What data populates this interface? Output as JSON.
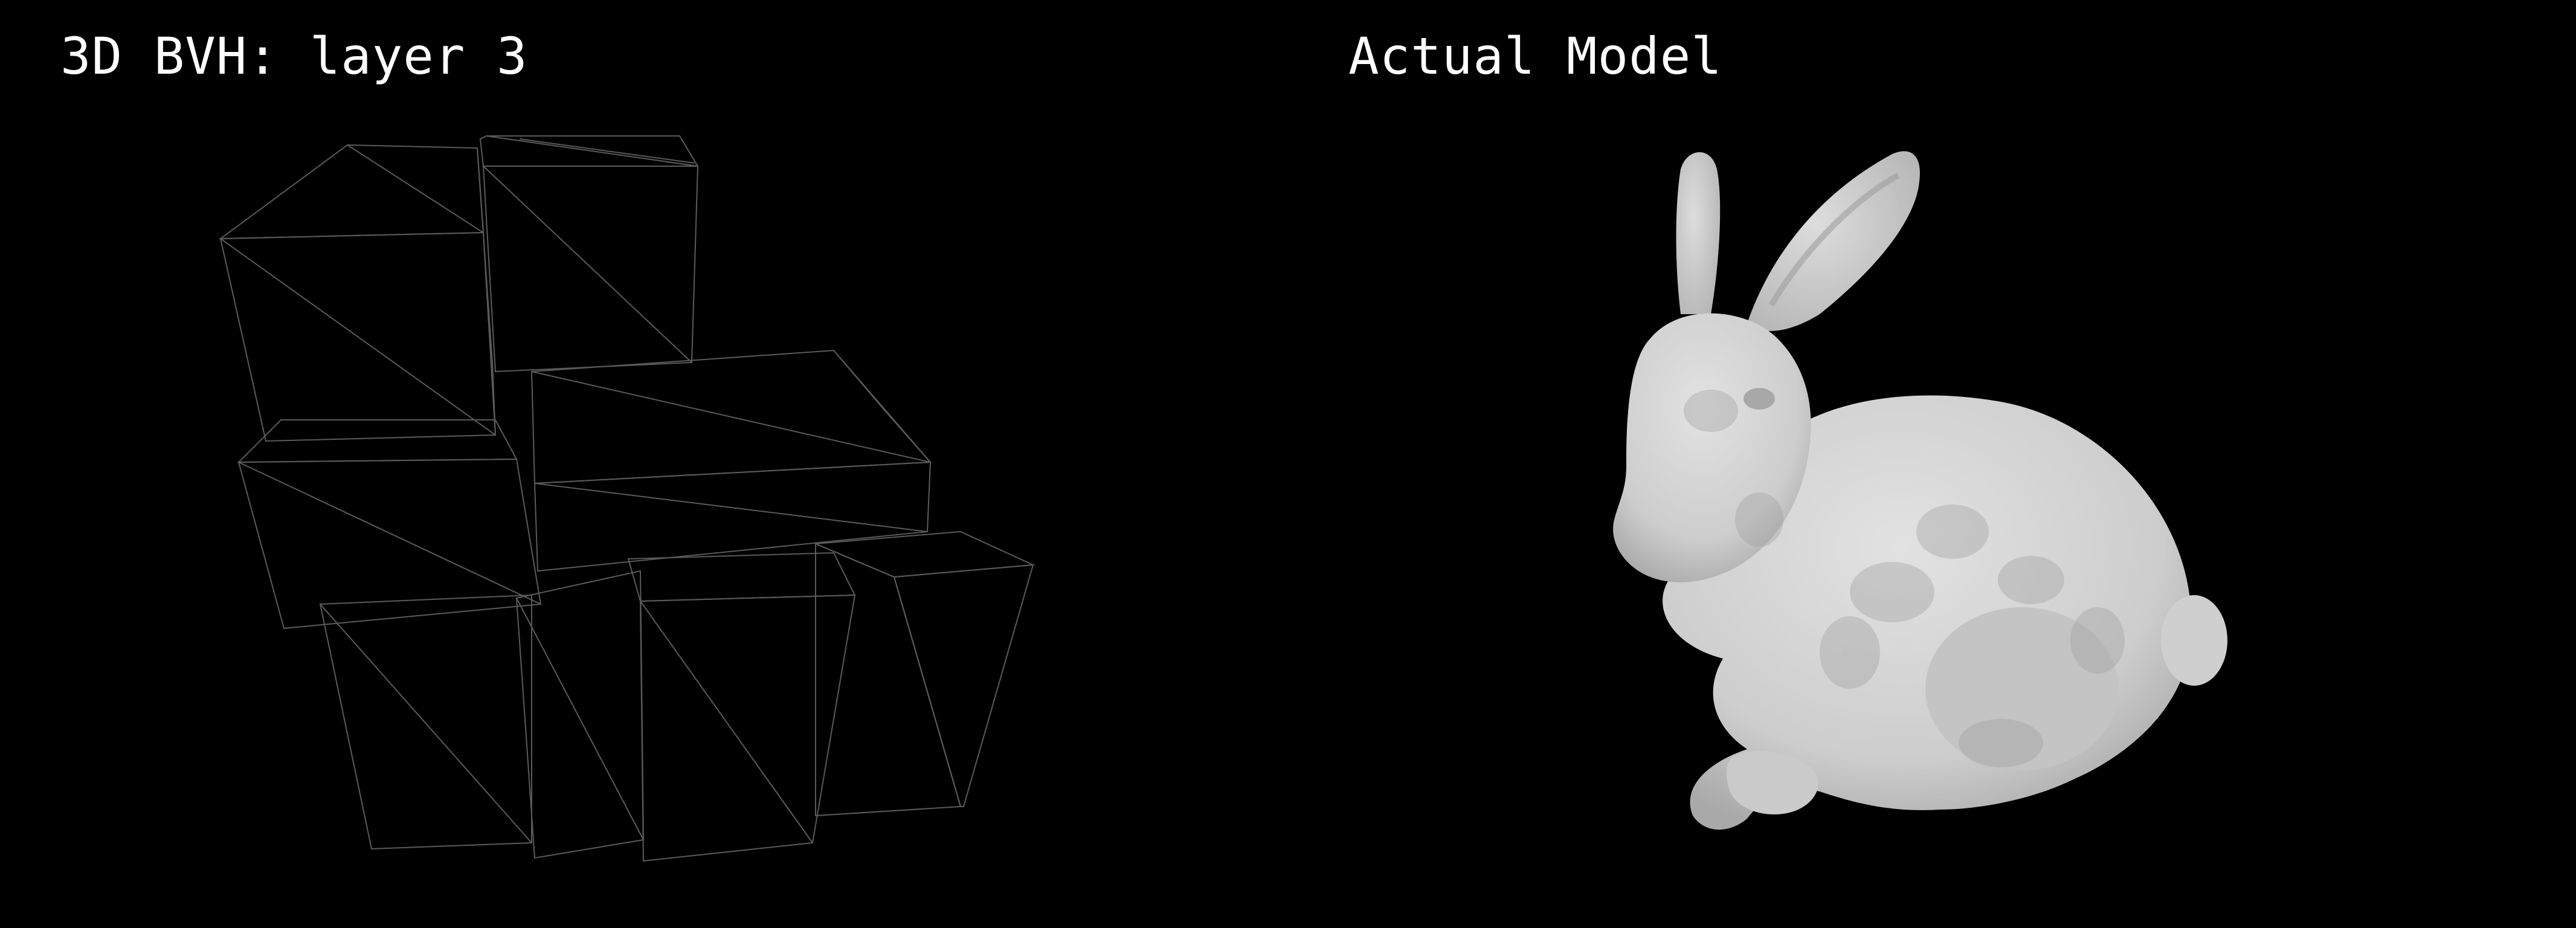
{
  "views": {
    "bvh": {
      "title": "3D BVH: layer 3"
    },
    "model": {
      "title": "Actual Model"
    }
  },
  "colors": {
    "background": "#000000",
    "face_light": "#cfcfcf",
    "face_dark": "#8a8a8a",
    "edge": "#5a5a5a",
    "text": "#ffffff"
  }
}
